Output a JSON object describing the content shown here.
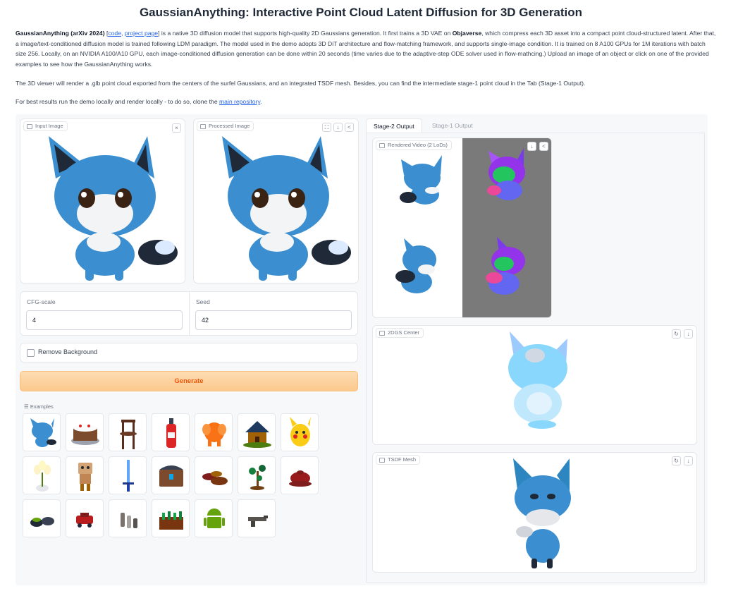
{
  "header": {
    "title": "GaussianAnything: Interactive Point Cloud Latent Diffusion for 3D Generation"
  },
  "intro": {
    "p1_bold": "GaussianAnything (arXiv 2024)",
    "p1_bracket_open": " [",
    "p1_link_code": "code",
    "p1_sep": ", ",
    "p1_link_project": "project page",
    "p1_text1": "] is a native 3D diffusion model that supports high-quality 2D Gaussians generation. It first trains a 3D VAE on ",
    "p1_bold2": "Objaverse",
    "p1_text2": ", which compress each 3D asset into a compact point cloud-structured latent. After that, a image/text-conditioned diffusion model is trained following LDM paradigm. The model used in the demo adopts 3D DiT architecture and flow-matching framework, and supports single-image condition. It is trained on 8 A100 GPUs for 1M iterations with batch size 256. Locally, on an NVIDIA A100/A10 GPU, each image-conditioned diffusion generation can be done within 20 seconds (time varies due to the adaptive-step ODE solver used in flow-mathcing.) Upload an image of an object or click on one of the provided examples to see how the GaussianAnything works.",
    "p2": "The 3D viewer will render a .glb point cloud exported from the centers of the surfel Gaussians, and an integrated TSDF mesh. Besides, you can find the intermediate stage-1 point cloud in the Tab (Stage-1 Output).",
    "p3_text": "For best results run the demo locally and render locally - to do so, clone the ",
    "p3_link": "main repository",
    "p3_end": "."
  },
  "input_image": {
    "label": "Input Image",
    "close": "×"
  },
  "processed_image": {
    "label": "Processed Image"
  },
  "controls": {
    "cfg_label": "CFG-scale",
    "cfg_value": "4",
    "seed_label": "Seed",
    "seed_value": "42",
    "remove_bg_label": "Remove Background",
    "remove_bg_checked": false,
    "generate_label": "Generate"
  },
  "examples": {
    "label": "Examples",
    "items": [
      "fox",
      "cake",
      "chair",
      "fire-extinguisher",
      "orange-elephant",
      "house",
      "pikachu",
      "tulips",
      "robot",
      "sword",
      "chest",
      "plates",
      "plant",
      "teapot",
      "shoes",
      "red-car",
      "bottles",
      "garden-bed",
      "android",
      "gun"
    ]
  },
  "output": {
    "tabs": [
      "Stage-2 Output",
      "Stage-1 Output"
    ],
    "active_tab": 0,
    "video_label": "Rendered Video (2 LoDs)",
    "gs_label": "2DGS Center",
    "mesh_label": "TSDF Mesh"
  },
  "colors": {
    "accent_orange": "#ea580c",
    "link_blue": "#2563eb",
    "fox_blue": "#3b8fd0",
    "normal_bg": "#7a7a7a"
  }
}
